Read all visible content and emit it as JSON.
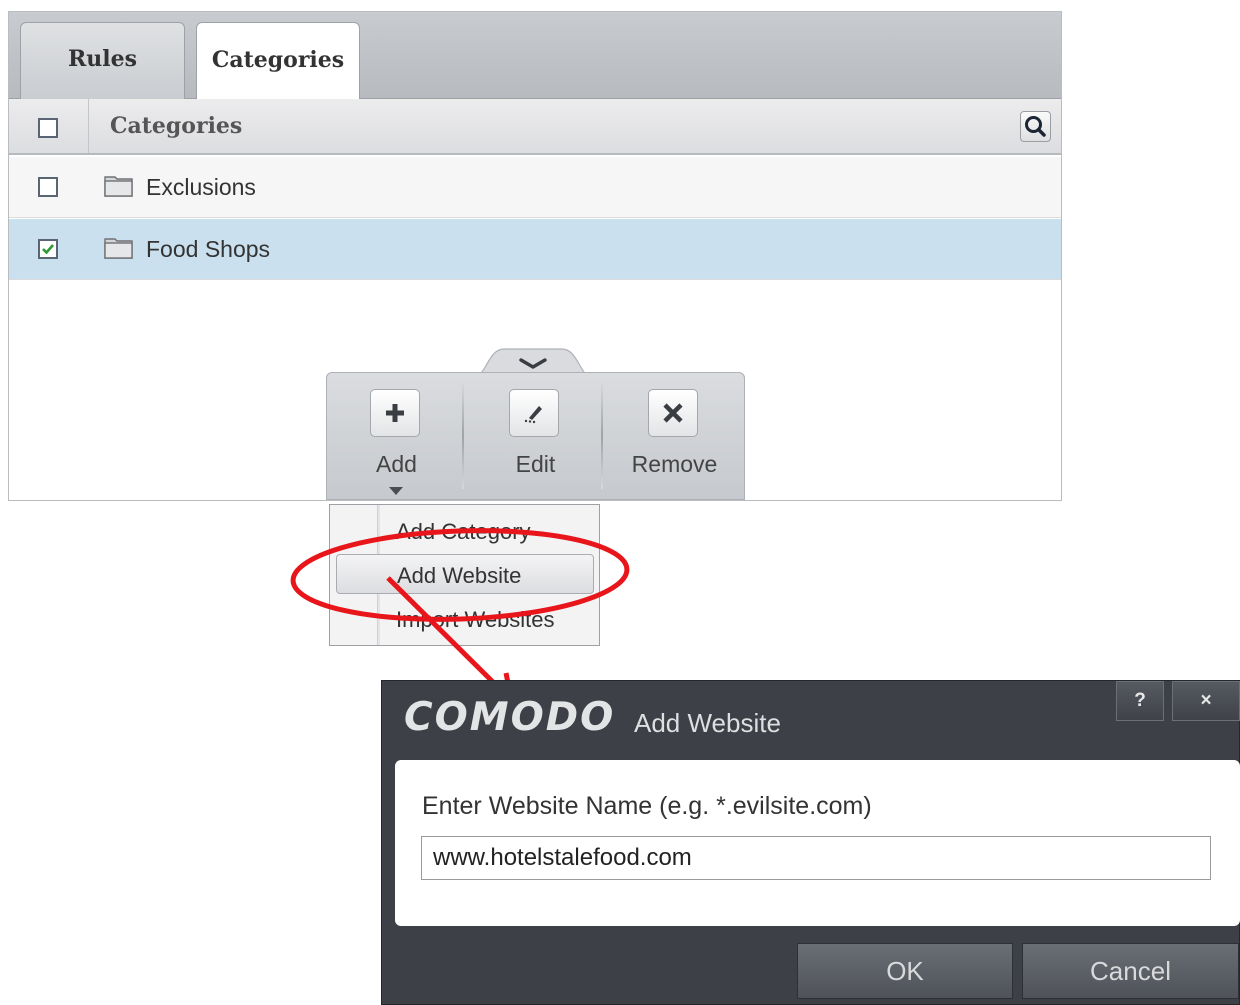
{
  "tabs": {
    "rules": "Rules",
    "categories": "Categories"
  },
  "table": {
    "header": "Categories",
    "rows": [
      {
        "name": "Exclusions",
        "checked": false
      },
      {
        "name": "Food Shops",
        "checked": true
      }
    ]
  },
  "toolbar": {
    "add": "Add",
    "edit": "Edit",
    "remove": "Remove"
  },
  "add_menu": {
    "items": [
      "Add Category",
      "Add Website",
      "Import Websites"
    ],
    "highlighted": "Add Website"
  },
  "dialog": {
    "brand": "COMODO",
    "title": "Add Website",
    "help": "?",
    "close": "×",
    "label": "Enter Website Name (e.g. *.evilsite.com)",
    "value": "www.hotelstalefood.com",
    "ok": "OK",
    "cancel": "Cancel"
  },
  "colors": {
    "selected_row": "#cbe0ee",
    "annotation": "#e8151b",
    "dialog_frame": "#3d4046"
  }
}
